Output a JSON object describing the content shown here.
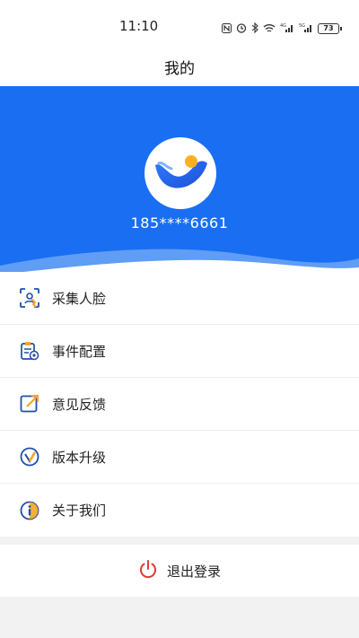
{
  "status_bar": {
    "time": "11:10",
    "battery": "73",
    "icons": [
      "nfc-icon",
      "alarm-icon",
      "bluetooth-icon",
      "wifi-icon",
      "signal-4g-icon",
      "signal-5g-icon",
      "battery-icon"
    ]
  },
  "header": {
    "title": "我的"
  },
  "profile": {
    "phone": "185****6661",
    "banner_color": "#1a6ef2"
  },
  "menu": {
    "items": [
      {
        "label": "采集人脸",
        "icon": "face-capture-icon"
      },
      {
        "label": "事件配置",
        "icon": "event-config-icon"
      },
      {
        "label": "意见反馈",
        "icon": "feedback-icon"
      },
      {
        "label": "版本升级",
        "icon": "version-upgrade-icon"
      },
      {
        "label": "关于我们",
        "icon": "about-info-icon"
      }
    ]
  },
  "logout": {
    "label": "退出登录",
    "icon": "power-icon",
    "icon_color": "#e53935"
  }
}
